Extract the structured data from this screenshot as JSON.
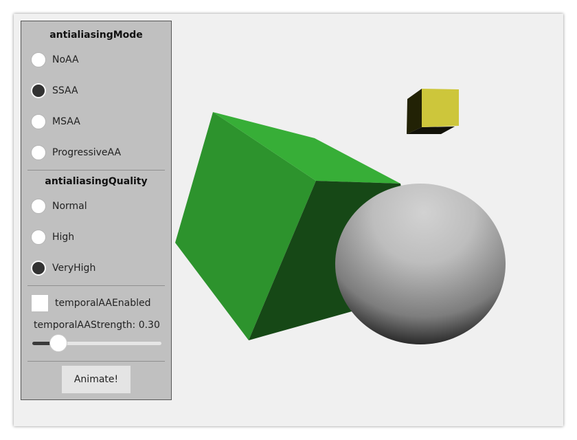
{
  "antialiasing_mode": {
    "heading": "antialiasingMode",
    "options": [
      {
        "label": "NoAA",
        "checked": false
      },
      {
        "label": "SSAA",
        "checked": true
      },
      {
        "label": "MSAA",
        "checked": false
      },
      {
        "label": "ProgressiveAA",
        "checked": false
      }
    ]
  },
  "antialiasing_quality": {
    "heading": "antialiasingQuality",
    "options": [
      {
        "label": "Normal",
        "checked": false
      },
      {
        "label": "High",
        "checked": false
      },
      {
        "label": "VeryHigh",
        "checked": true
      }
    ]
  },
  "temporal": {
    "checkbox_label": "temporalAAEnabled",
    "checked": false,
    "strength_label": "temporalAAStrength: 0.30",
    "strength_value": 0.3
  },
  "animate_button": "Animate!",
  "colors": {
    "panel_bg": "#c0c0c0",
    "cube_green": "#2e962e",
    "small_cube_yellow": "#cec43a",
    "slider_fill": "#3a3a3a"
  }
}
